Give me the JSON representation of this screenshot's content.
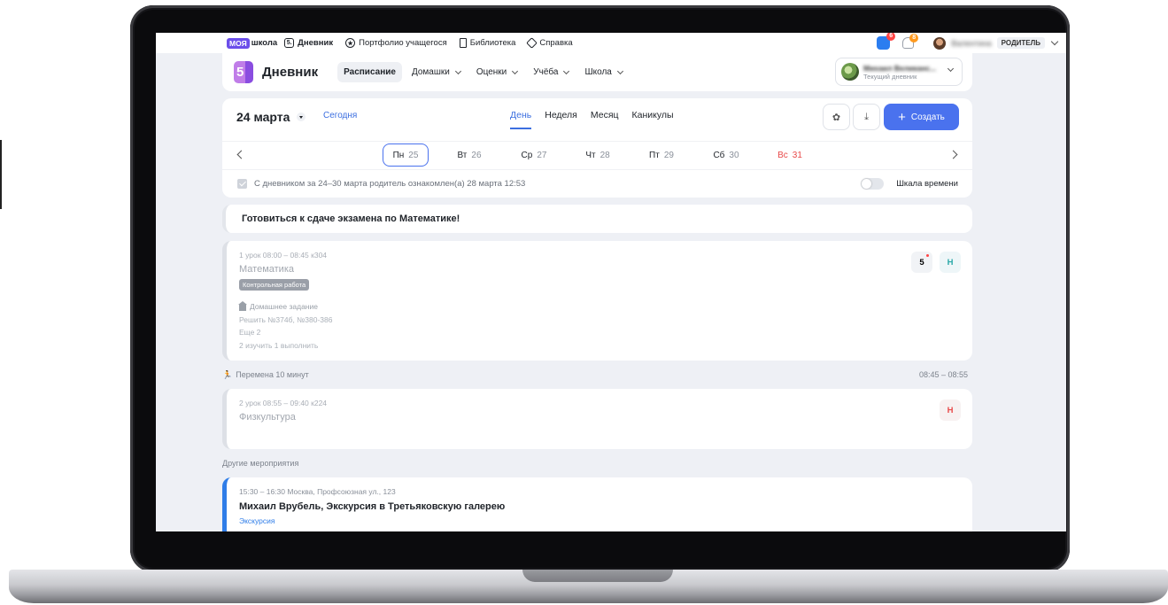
{
  "sysbar": {
    "brand_my": "МОЯ",
    "brand_school": "школа",
    "diary_icon": "5.",
    "diary_label": "Дневник",
    "portfolio_label": "Портфолио учащегося",
    "library_label": "Библиотека",
    "help_label": "Справка",
    "apps_badge": "6",
    "notifications_badge": "8",
    "user_name": "Валентина",
    "role": "РОДИТЕЛЬ"
  },
  "header": {
    "logo_text": "5",
    "title": "Дневник",
    "nav": [
      "Расписание",
      "Домашки",
      "Оценки",
      "Учёба",
      "Школа"
    ],
    "active_nav": "Расписание",
    "child_name": "Михаил Великанс...",
    "child_sub": "Текущий дневник"
  },
  "schedule": {
    "date_title": "24 марта",
    "today_link": "Сегодня",
    "view_tabs": [
      "День",
      "Неделя",
      "Месяц",
      "Каникулы"
    ],
    "active_view": "День",
    "create_label": "Создать",
    "days": [
      {
        "name": "Пн",
        "num": "25",
        "active": true
      },
      {
        "name": "Вт",
        "num": "26"
      },
      {
        "name": "Ср",
        "num": "27"
      },
      {
        "name": "Чт",
        "num": "28"
      },
      {
        "name": "Пт",
        "num": "29"
      },
      {
        "name": "Сб",
        "num": "30"
      },
      {
        "name": "Вс",
        "num": "31",
        "weekend": true
      }
    ],
    "ack_text": "С дневником за 24–30 марта родитель ознакомлен(а) 28 марта 12:53",
    "timeline_label": "Шкала времени",
    "timeline_on": false
  },
  "announcement": "Готовиться к сдаче экзамена по Математике!",
  "lessons": [
    {
      "meta": "1 урок  08:00 – 08:45  к304",
      "subject": "Математика",
      "tag": "Контрольная работа",
      "hw_title": "Домашнее задание",
      "hw_text": "Решить №374б, №380-386",
      "hw_more": "Еще 2",
      "hw_stats": "2 изучить  1 выполнить",
      "grade": "5",
      "attendance": "Н"
    },
    {
      "meta": "2 урок  08:55 – 09:40  к224",
      "subject": "Физкультура",
      "attendance": "Н"
    }
  ],
  "break": {
    "label": "Перемена 10 минут",
    "time": "08:45 – 08:55"
  },
  "other_title": "Другие мероприятия",
  "event": {
    "meta": "15:30 – 16:30  Москва, Профсоюзная ул., 123",
    "title": "Михаил Врубель, Экскурсия в Третьяковскую галерею",
    "type": "Экскурсия"
  },
  "colors": {
    "accent": "#4a72ee",
    "brand_purple": "#6b4eea",
    "weekend_red": "#e84a4a",
    "event_blue": "#2f7de8"
  }
}
